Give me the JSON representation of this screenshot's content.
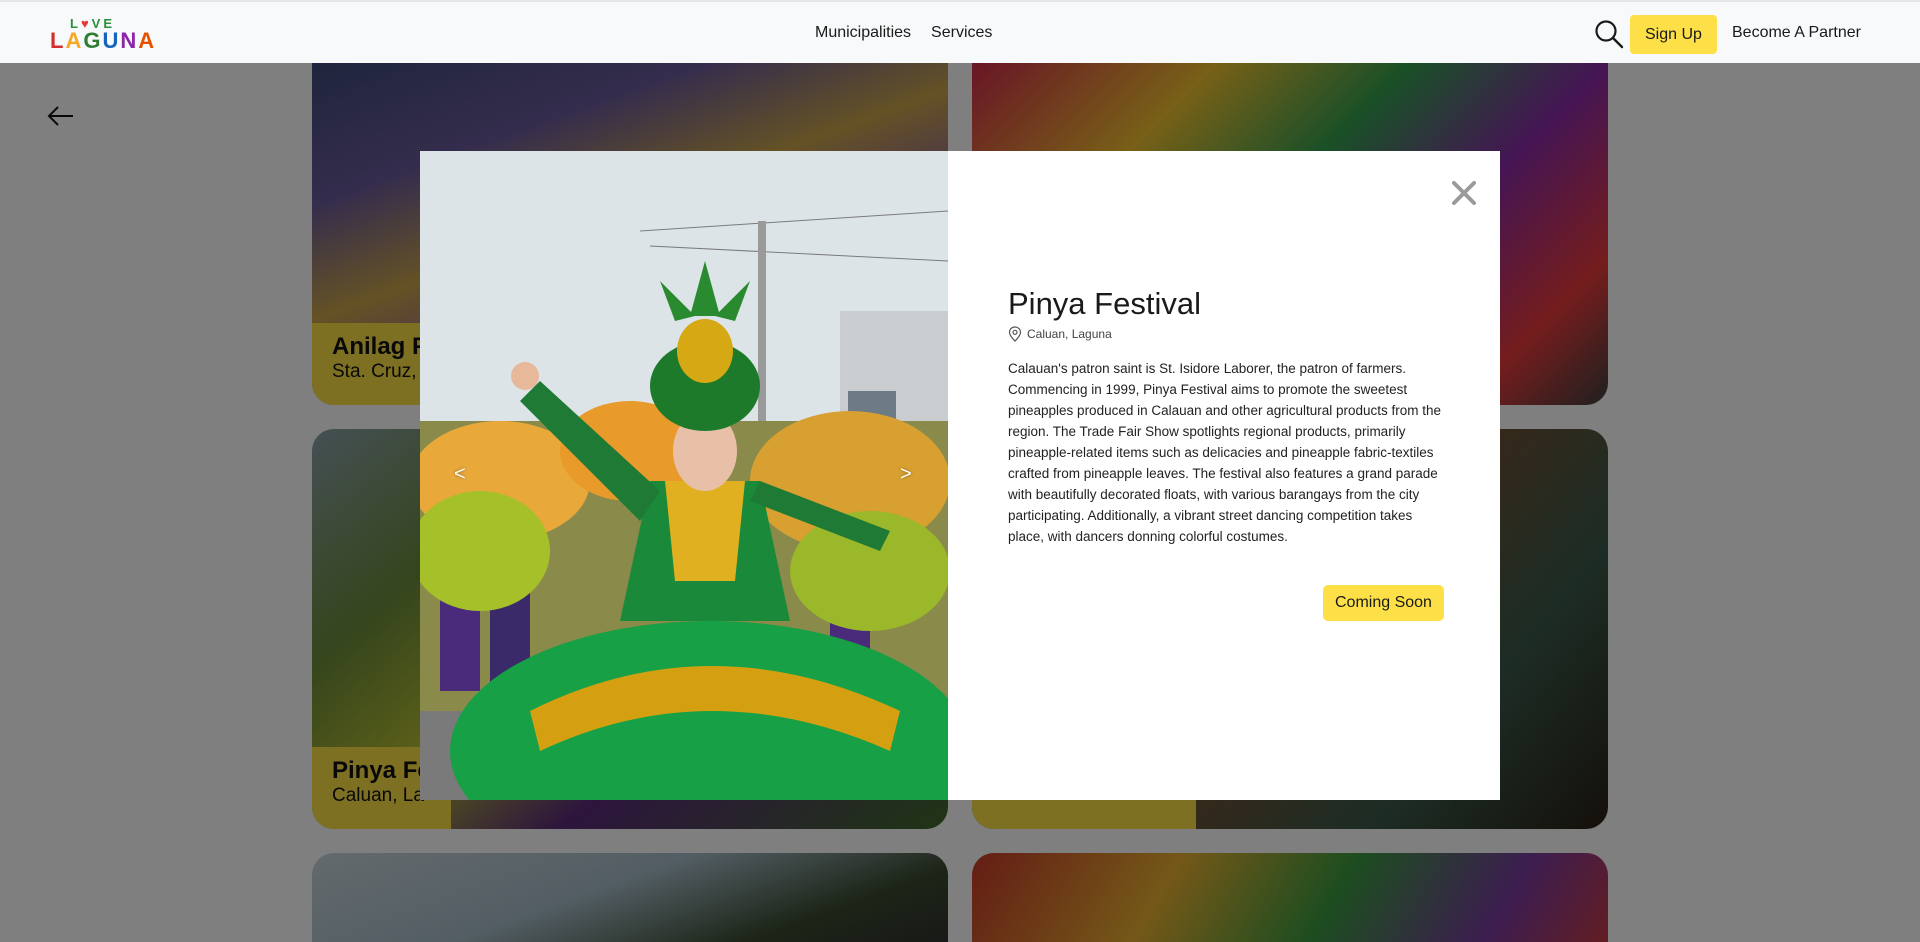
{
  "header": {
    "logo_love": "LOVE",
    "logo_laguna": "LAGUNA",
    "nav": [
      "Municipalities",
      "Services"
    ],
    "search_icon": "search-icon",
    "signup_label": "Sign Up",
    "partner_label": "Become A Partner"
  },
  "back": {
    "icon": "arrow-left-icon"
  },
  "cards": [
    {
      "title": "Anilag F",
      "subtitle": "Sta. Cruz,"
    },
    {
      "title": "Pinya Fe",
      "subtitle": "Caluan, La"
    }
  ],
  "modal": {
    "title": "Pinya Festival",
    "location": "Caluan, Laguna",
    "location_icon": "map-pin-icon",
    "description": "Calauan's patron saint is St. Isidore Laborer, the patron of farmers. Commencing in 1999, Pinya Festival aims to promote the sweetest pineapples produced in Calauan and other agricultural products from the region. The Trade Fair Show spotlights regional products, primarily pineapple-related items such as delicacies and pineapple fabric-textiles crafted from pineapple leaves. The festival also features a grand parade with beautifully decorated floats, with various barangays from the city participating. Additionally, a vibrant street dancing competition takes place, with dancers donning colorful costumes.",
    "button_label": "Coming Soon",
    "prev_arrow": "<",
    "next_arrow": ">",
    "close_icon": "close-icon"
  },
  "colors": {
    "accent": "#fde047",
    "overlay": "rgba(0,0,0,0.5)"
  }
}
